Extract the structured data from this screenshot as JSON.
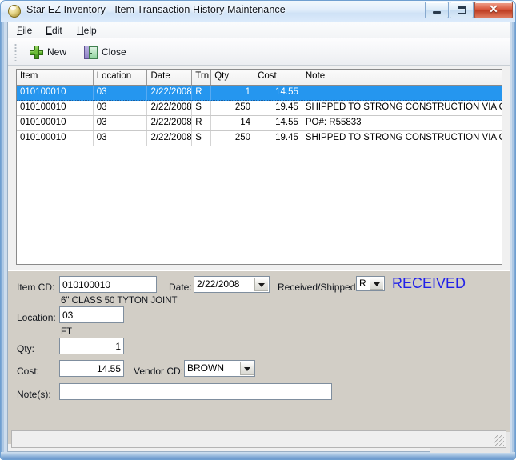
{
  "window": {
    "title": "Star EZ Inventory - Item Transaction History Maintenance",
    "icon": "globe-icon",
    "buttons": {
      "minimize": "minimize-icon",
      "maximize": "maximize-icon",
      "close": "✕"
    }
  },
  "menubar": {
    "items": [
      {
        "label": "File",
        "accel": "F"
      },
      {
        "label": "Edit",
        "accel": "E"
      },
      {
        "label": "Help",
        "accel": "H"
      }
    ]
  },
  "toolbar": {
    "new_label": "New",
    "new_icon": "green-plus-icon",
    "close_label": "Close",
    "close_icon": "door-exit-icon"
  },
  "grid": {
    "columns": [
      "Item",
      "Location",
      "Date",
      "Trn",
      "Qty",
      "Cost",
      "Note"
    ],
    "rows": [
      {
        "item": "010100010",
        "location": "03",
        "date": "2/22/2008",
        "trn": "R",
        "qty": "1",
        "cost": "14.55",
        "note": "",
        "selected": true
      },
      {
        "item": "010100010",
        "location": "03",
        "date": "2/22/2008",
        "trn": "S",
        "qty": "250",
        "cost": "19.45",
        "note": "SHIPPED TO STRONG CONSTRUCTION VIA OUR TRUC",
        "selected": false
      },
      {
        "item": "010100010",
        "location": "03",
        "date": "2/22/2008",
        "trn": "R",
        "qty": "14",
        "cost": "14.55",
        "note": "PO#: R55833",
        "selected": false
      },
      {
        "item": "010100010",
        "location": "03",
        "date": "2/22/2008",
        "trn": "S",
        "qty": "250",
        "cost": "19.45",
        "note": "SHIPPED TO STRONG CONSTRUCTION VIA OUR TRUC",
        "selected": false
      }
    ]
  },
  "detail": {
    "item_cd_label": "Item CD:",
    "item_cd_value": "010100010",
    "item_description": "6\" CLASS 50 TYTON JOINT",
    "date_label": "Date:",
    "date_value": "2/22/2008",
    "received_shipped_label": "Received/Shipped:",
    "received_shipped_value": "R",
    "received_shipped_flag": "RECEIVED",
    "received_flag_color": "#2222e8",
    "location_label": "Location:",
    "location_value": "03",
    "unit_of_measure": "FT",
    "qty_label": "Qty:",
    "qty_value": "1",
    "cost_label": "Cost:",
    "cost_value": "14.55",
    "vendor_cd_label": "Vendor CD:",
    "vendor_cd_value": "BROWN",
    "notes_label": "Note(s):",
    "notes_value": ""
  },
  "navigator": {
    "first_icon": "first-record-icon",
    "previous_icon": "previous-record-icon",
    "next_icon": "next-record-icon",
    "last_icon": "last-record-icon"
  },
  "statusbar": {
    "text": "",
    "grip_icon": "resize-grip-icon"
  }
}
